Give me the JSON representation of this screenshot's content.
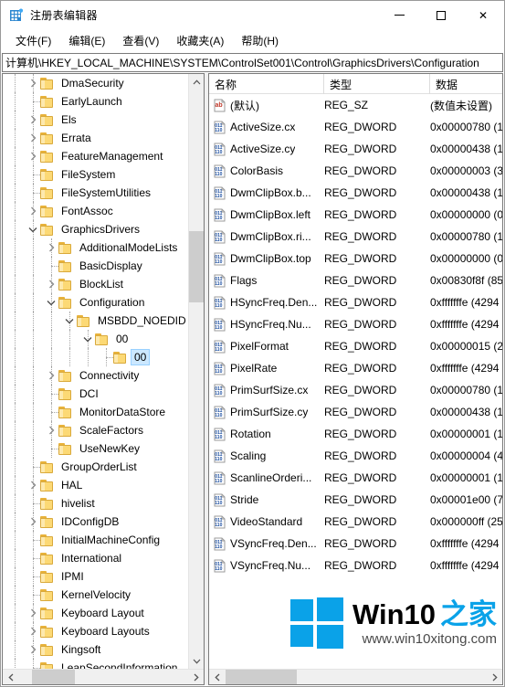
{
  "window": {
    "title": "注册表编辑器",
    "icon": "registry-editor-icon",
    "minimize_label": "",
    "maximize_label": "",
    "close_label": "✕"
  },
  "menu": {
    "items": [
      {
        "label": "文件(F)"
      },
      {
        "label": "编辑(E)"
      },
      {
        "label": "查看(V)"
      },
      {
        "label": "收藏夹(A)"
      },
      {
        "label": "帮助(H)"
      }
    ]
  },
  "address": {
    "path": "计算机\\HKEY_LOCAL_MACHINE\\SYSTEM\\ControlSet001\\Control\\GraphicsDrivers\\Configuration"
  },
  "tree": {
    "nodes": [
      {
        "label": "DmaSecurity",
        "depth": 2,
        "twisty": "collapsed",
        "selected": false
      },
      {
        "label": "EarlyLaunch",
        "depth": 2,
        "twisty": "none",
        "selected": false
      },
      {
        "label": "Els",
        "depth": 2,
        "twisty": "collapsed",
        "selected": false
      },
      {
        "label": "Errata",
        "depth": 2,
        "twisty": "collapsed",
        "selected": false
      },
      {
        "label": "FeatureManagement",
        "depth": 2,
        "twisty": "collapsed",
        "selected": false
      },
      {
        "label": "FileSystem",
        "depth": 2,
        "twisty": "none",
        "selected": false
      },
      {
        "label": "FileSystemUtilities",
        "depth": 2,
        "twisty": "none",
        "selected": false
      },
      {
        "label": "FontAssoc",
        "depth": 2,
        "twisty": "collapsed",
        "selected": false
      },
      {
        "label": "GraphicsDrivers",
        "depth": 2,
        "twisty": "expanded",
        "selected": false
      },
      {
        "label": "AdditionalModeLists",
        "depth": 3,
        "twisty": "collapsed",
        "selected": false
      },
      {
        "label": "BasicDisplay",
        "depth": 3,
        "twisty": "none",
        "selected": false
      },
      {
        "label": "BlockList",
        "depth": 3,
        "twisty": "collapsed",
        "selected": false
      },
      {
        "label": "Configuration",
        "depth": 3,
        "twisty": "expanded",
        "selected": false
      },
      {
        "label": "MSBDD_NOEDID",
        "depth": 4,
        "twisty": "expanded",
        "selected": false
      },
      {
        "label": "00",
        "depth": 5,
        "twisty": "expanded",
        "selected": false
      },
      {
        "label": "00",
        "depth": 6,
        "twisty": "none",
        "selected": true
      },
      {
        "label": "Connectivity",
        "depth": 3,
        "twisty": "collapsed",
        "selected": false
      },
      {
        "label": "DCI",
        "depth": 3,
        "twisty": "none",
        "selected": false
      },
      {
        "label": "MonitorDataStore",
        "depth": 3,
        "twisty": "none",
        "selected": false
      },
      {
        "label": "ScaleFactors",
        "depth": 3,
        "twisty": "collapsed",
        "selected": false
      },
      {
        "label": "UseNewKey",
        "depth": 3,
        "twisty": "none",
        "selected": false
      },
      {
        "label": "GroupOrderList",
        "depth": 2,
        "twisty": "none",
        "selected": false
      },
      {
        "label": "HAL",
        "depth": 2,
        "twisty": "collapsed",
        "selected": false
      },
      {
        "label": "hivelist",
        "depth": 2,
        "twisty": "none",
        "selected": false
      },
      {
        "label": "IDConfigDB",
        "depth": 2,
        "twisty": "collapsed",
        "selected": false
      },
      {
        "label": "InitialMachineConfig",
        "depth": 2,
        "twisty": "none",
        "selected": false
      },
      {
        "label": "International",
        "depth": 2,
        "twisty": "none",
        "selected": false
      },
      {
        "label": "IPMI",
        "depth": 2,
        "twisty": "none",
        "selected": false
      },
      {
        "label": "KernelVelocity",
        "depth": 2,
        "twisty": "none",
        "selected": false
      },
      {
        "label": "Keyboard Layout",
        "depth": 2,
        "twisty": "collapsed",
        "selected": false
      },
      {
        "label": "Keyboard Layouts",
        "depth": 2,
        "twisty": "collapsed",
        "selected": false
      },
      {
        "label": "Kingsoft",
        "depth": 2,
        "twisty": "collapsed",
        "selected": false
      },
      {
        "label": "LeapSecondInformation",
        "depth": 2,
        "twisty": "none",
        "selected": false
      }
    ]
  },
  "list": {
    "columns": [
      {
        "label": "名称"
      },
      {
        "label": "类型"
      },
      {
        "label": "数据"
      }
    ],
    "rows": [
      {
        "icon": "string-value-icon",
        "name": "(默认)",
        "type": "REG_SZ",
        "data": "(数值未设置)"
      },
      {
        "icon": "dword-value-icon",
        "name": "ActiveSize.cx",
        "type": "REG_DWORD",
        "data": "0x00000780 (1"
      },
      {
        "icon": "dword-value-icon",
        "name": "ActiveSize.cy",
        "type": "REG_DWORD",
        "data": "0x00000438 (1"
      },
      {
        "icon": "dword-value-icon",
        "name": "ColorBasis",
        "type": "REG_DWORD",
        "data": "0x00000003 (3"
      },
      {
        "icon": "dword-value-icon",
        "name": "DwmClipBox.b...",
        "type": "REG_DWORD",
        "data": "0x00000438 (1"
      },
      {
        "icon": "dword-value-icon",
        "name": "DwmClipBox.left",
        "type": "REG_DWORD",
        "data": "0x00000000 (0"
      },
      {
        "icon": "dword-value-icon",
        "name": "DwmClipBox.ri...",
        "type": "REG_DWORD",
        "data": "0x00000780 (1"
      },
      {
        "icon": "dword-value-icon",
        "name": "DwmClipBox.top",
        "type": "REG_DWORD",
        "data": "0x00000000 (0"
      },
      {
        "icon": "dword-value-icon",
        "name": "Flags",
        "type": "REG_DWORD",
        "data": "0x00830f8f (85"
      },
      {
        "icon": "dword-value-icon",
        "name": "HSyncFreq.Den...",
        "type": "REG_DWORD",
        "data": "0xfffffffe (4294"
      },
      {
        "icon": "dword-value-icon",
        "name": "HSyncFreq.Nu...",
        "type": "REG_DWORD",
        "data": "0xfffffffe (4294"
      },
      {
        "icon": "dword-value-icon",
        "name": "PixelFormat",
        "type": "REG_DWORD",
        "data": "0x00000015 (2"
      },
      {
        "icon": "dword-value-icon",
        "name": "PixelRate",
        "type": "REG_DWORD",
        "data": "0xfffffffe (4294"
      },
      {
        "icon": "dword-value-icon",
        "name": "PrimSurfSize.cx",
        "type": "REG_DWORD",
        "data": "0x00000780 (1"
      },
      {
        "icon": "dword-value-icon",
        "name": "PrimSurfSize.cy",
        "type": "REG_DWORD",
        "data": "0x00000438 (1"
      },
      {
        "icon": "dword-value-icon",
        "name": "Rotation",
        "type": "REG_DWORD",
        "data": "0x00000001 (1"
      },
      {
        "icon": "dword-value-icon",
        "name": "Scaling",
        "type": "REG_DWORD",
        "data": "0x00000004 (4"
      },
      {
        "icon": "dword-value-icon",
        "name": "ScanlineOrderi...",
        "type": "REG_DWORD",
        "data": "0x00000001 (1"
      },
      {
        "icon": "dword-value-icon",
        "name": "Stride",
        "type": "REG_DWORD",
        "data": "0x00001e00 (7"
      },
      {
        "icon": "dword-value-icon",
        "name": "VideoStandard",
        "type": "REG_DWORD",
        "data": "0x000000ff (25"
      },
      {
        "icon": "dword-value-icon",
        "name": "VSyncFreq.Den...",
        "type": "REG_DWORD",
        "data": "0xfffffffe (4294"
      },
      {
        "icon": "dword-value-icon",
        "name": "VSyncFreq.Nu...",
        "type": "REG_DWORD",
        "data": "0xfffffffe (4294"
      }
    ]
  },
  "watermark": {
    "brand": "Win10",
    "brand_cn": "之家",
    "url": "www.win10xitong.com",
    "accent_color": "#0aa2e8"
  },
  "scrollbars": {
    "tree_up_arrow": "︿",
    "tree_down_arrow": "﹀",
    "left_arrow": "‹",
    "right_arrow": "›"
  }
}
